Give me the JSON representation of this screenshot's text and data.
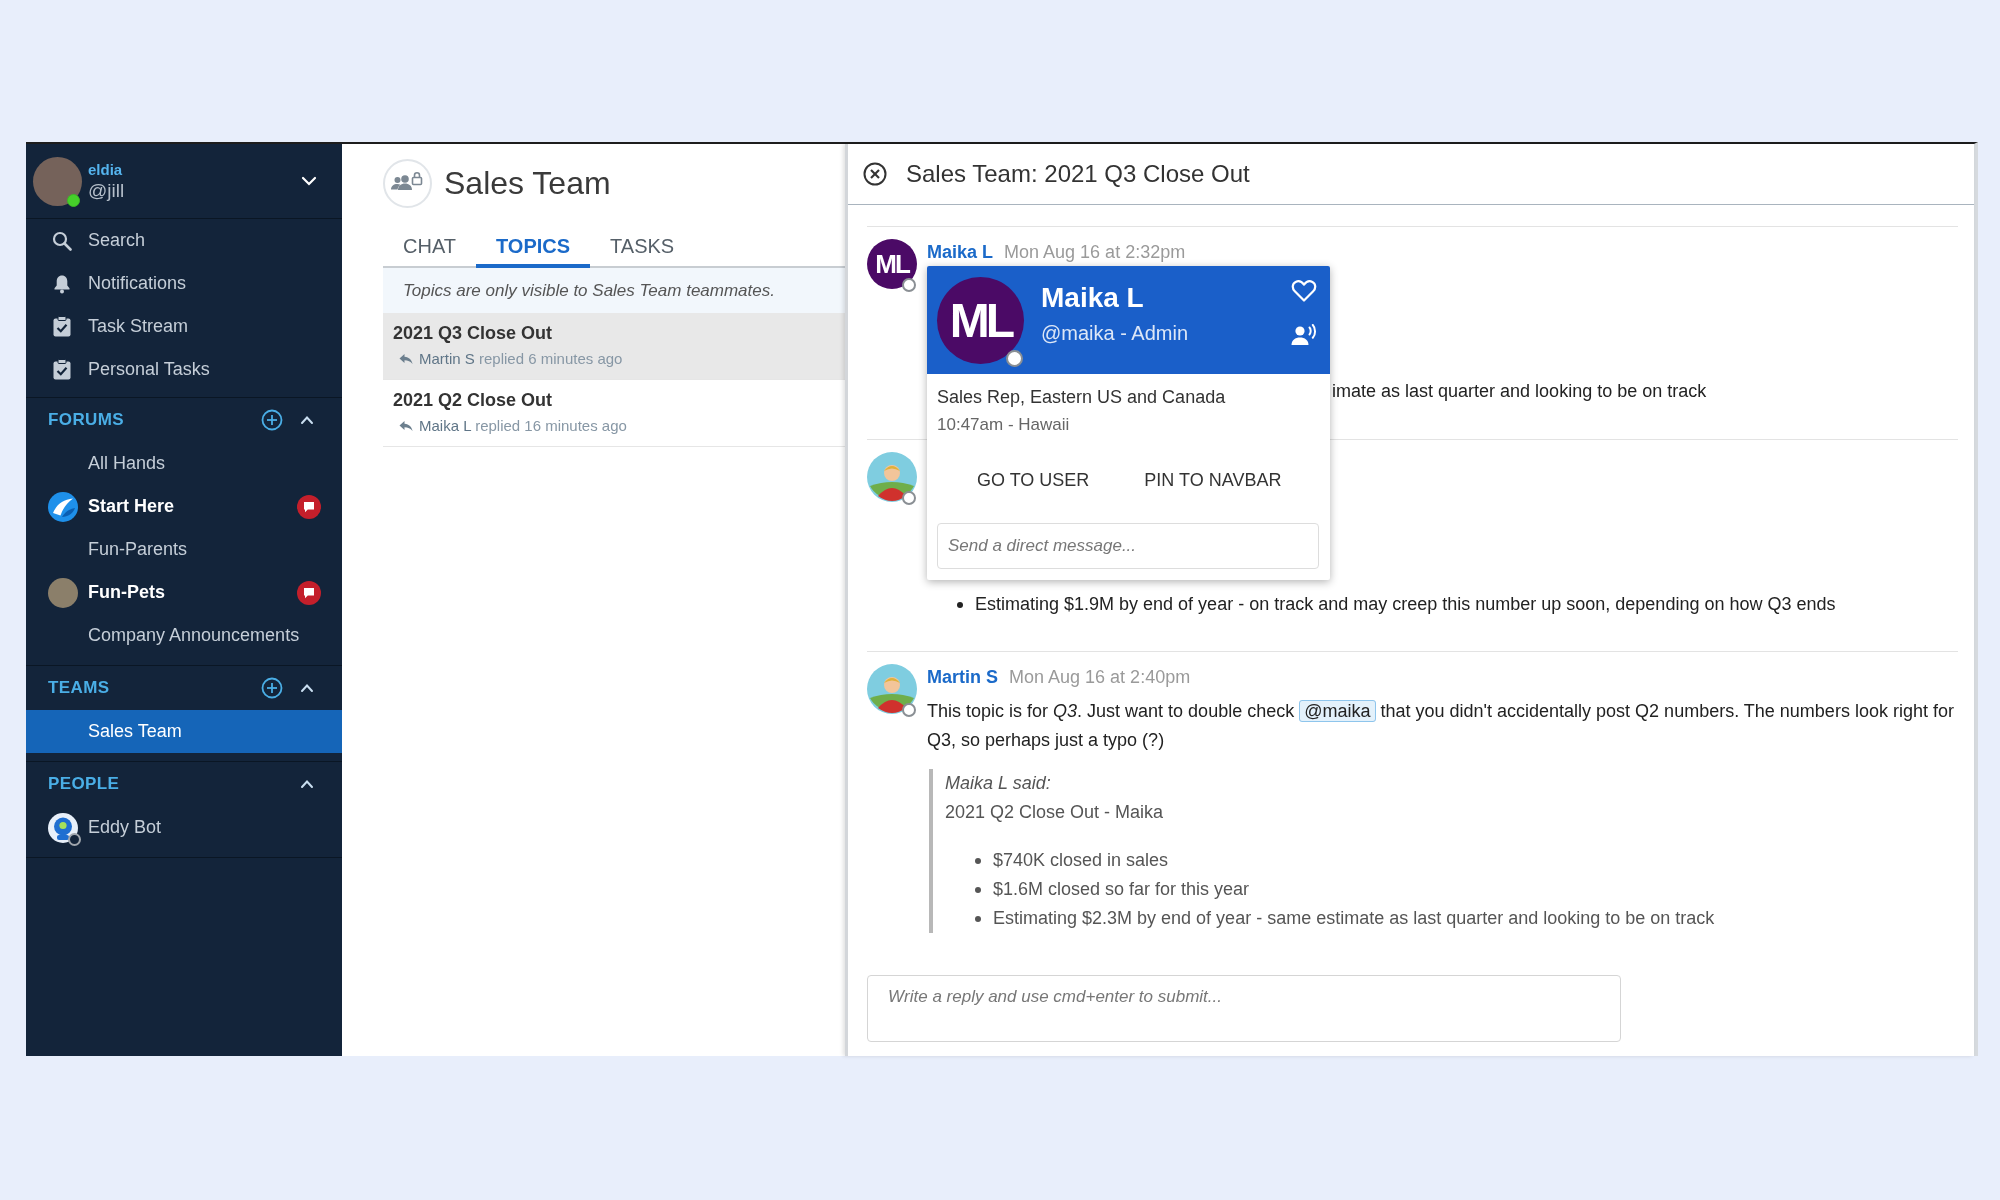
{
  "sidebar": {
    "user": {
      "name": "eldia",
      "handle": "@jill",
      "online": true
    },
    "nav": [
      {
        "label": "Search",
        "selected": false
      },
      {
        "label": "Notifications",
        "selected": false
      },
      {
        "label": "Task Stream",
        "selected": false
      },
      {
        "label": "Personal Tasks",
        "selected": false
      }
    ],
    "sections": [
      {
        "title": "FORUMS",
        "can_add": true,
        "expanded": true,
        "items": [
          {
            "label": "All Hands",
            "kind": "plain",
            "unread": false,
            "selected": false
          },
          {
            "label": "Start Here",
            "kind": "logo",
            "unread": true,
            "selected": false
          },
          {
            "label": "Fun-Parents",
            "kind": "plain",
            "unread": false,
            "selected": false
          },
          {
            "label": "Fun-Pets",
            "kind": "photo",
            "unread": true,
            "selected": false
          },
          {
            "label": "Company Announcements",
            "kind": "plain",
            "unread": false,
            "selected": false
          }
        ]
      },
      {
        "title": "TEAMS",
        "can_add": true,
        "expanded": true,
        "items": [
          {
            "label": "Sales Team",
            "kind": "plain",
            "unread": false,
            "selected": true
          }
        ]
      },
      {
        "title": "PEOPLE",
        "can_add": false,
        "expanded": true,
        "items": [
          {
            "label": "Eddy Bot",
            "kind": "bot",
            "unread": false,
            "selected": false,
            "online": false
          }
        ]
      }
    ]
  },
  "channel": {
    "title": "Sales Team",
    "tabs": [
      {
        "label": "CHAT",
        "selected": false
      },
      {
        "label": "TOPICS",
        "selected": true
      },
      {
        "label": "TASKS",
        "selected": false
      }
    ],
    "notice": "Topics are only visible to Sales Team teammates.",
    "topics": [
      {
        "title": "2021 Q3 Close Out",
        "replied_by": "Martin S",
        "reply_text": "replied 6 minutes ago",
        "selected": true
      },
      {
        "title": "2021 Q2 Close Out",
        "replied_by": "Maika L",
        "reply_text": "replied 16 minutes ago",
        "selected": false
      }
    ]
  },
  "thread": {
    "title": "Sales Team: 2021 Q3 Close Out",
    "messages": [
      {
        "avatar": {
          "kind": "initials",
          "initials": "ML",
          "online": false
        },
        "author": "Maika L",
        "time": "Mon Aug 16 at 2:32pm",
        "text_fragment": "imate as last quarter and looking to be on track"
      },
      {
        "avatar": {
          "kind": "drawing",
          "online": false
        },
        "bullets": [
          "Estimating $1.9M by end of year - on track and may creep this number up soon, depending on how Q3 ends"
        ]
      },
      {
        "avatar": {
          "kind": "drawing",
          "online": false
        },
        "author": "Martin S",
        "time": "Mon Aug 16 at 2:40pm",
        "text_before": "This topic is for *Q3*. Just want to double check",
        "mention": "@maika",
        "text_after": "that you didn't accidentally post Q2 numbers. The numbers look right for Q3, so perhaps just a typo (?)",
        "quote": {
          "attribution": "Maika L said:",
          "title": "2021 Q2 Close Out - Maika",
          "bullets": [
            "$740K closed in sales",
            "$1.6M closed so far for this year",
            "Estimating $2.3M by end of year - same estimate as last quarter and looking to be on track"
          ]
        }
      }
    ],
    "reply_placeholder": "Write a reply and use cmd+enter to submit..."
  },
  "profile_card": {
    "initials": "ML",
    "name": "Maika L",
    "handle": "@maika - Admin",
    "online": false,
    "favorite": false,
    "job_title": "Sales Rep, Eastern US and Canada",
    "local_time": "10:47am - Hawaii",
    "actions": [
      "GO TO USER",
      "PIN TO NAVBAR"
    ],
    "message_placeholder": "Send a direct message..."
  }
}
